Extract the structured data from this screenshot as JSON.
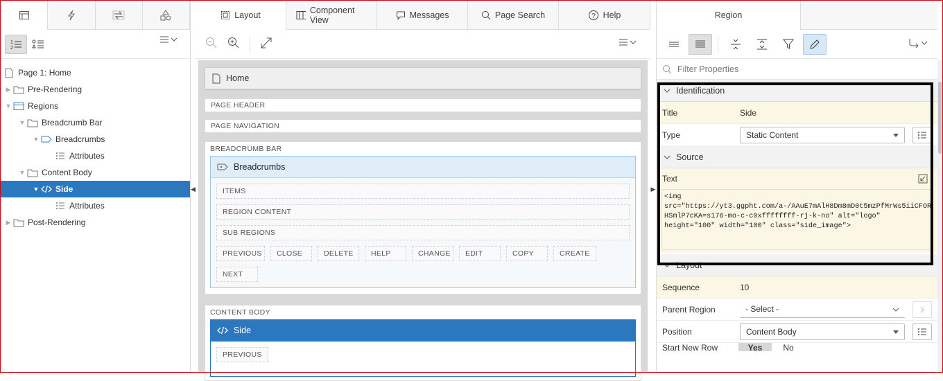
{
  "left": {
    "tabs": [
      "rendering-tab",
      "dynamic-actions-tab",
      "processing-tab",
      "shared-components-tab"
    ],
    "tree": [
      {
        "label": "Page 1: Home",
        "depth": 0,
        "toggle": "",
        "icon": "page"
      },
      {
        "label": "Pre-Rendering",
        "depth": 0,
        "toggle": "▶",
        "icon": "folder"
      },
      {
        "label": "Regions",
        "depth": 0,
        "toggle": "▼",
        "icon": "region"
      },
      {
        "label": "Breadcrumb Bar",
        "depth": 1,
        "toggle": "▼",
        "icon": "folder"
      },
      {
        "label": "Breadcrumbs",
        "depth": 2,
        "toggle": "▼",
        "icon": "breadcrumb"
      },
      {
        "label": "Attributes",
        "depth": 3,
        "toggle": "",
        "icon": "list"
      },
      {
        "label": "Content Body",
        "depth": 1,
        "toggle": "▼",
        "icon": "folder"
      },
      {
        "label": "Side",
        "depth": 2,
        "toggle": "▼",
        "icon": "code",
        "selected": true
      },
      {
        "label": "Attributes",
        "depth": 3,
        "toggle": "",
        "icon": "list"
      },
      {
        "label": "Post-Rendering",
        "depth": 0,
        "toggle": "▶",
        "icon": "folder"
      }
    ]
  },
  "middle": {
    "tabs": {
      "layout": "Layout",
      "component_view": "Component View",
      "messages": "Messages",
      "page_search": "Page Search",
      "help": "Help"
    },
    "page_title": "Home",
    "page_header": "PAGE HEADER",
    "page_navigation": "PAGE NAVIGATION",
    "breadcrumb_bar": "BREADCRUMB BAR",
    "breadcrumbs_region": "Breadcrumbs",
    "items": "ITEMS",
    "region_content": "REGION CONTENT",
    "sub_regions": "SUB REGIONS",
    "buttons": [
      "PREVIOUS",
      "CLOSE",
      "DELETE",
      "HELP",
      "CHANGE",
      "EDIT",
      "COPY",
      "CREATE",
      "NEXT"
    ],
    "content_body": "CONTENT BODY",
    "side_region": "Side",
    "side_previous": "PREVIOUS"
  },
  "right": {
    "tab": "Region",
    "filter_placeholder": "Filter Properties",
    "identification": "Identification",
    "title_label": "Title",
    "title_value": "Side",
    "type_label": "Type",
    "type_value": "Static Content",
    "source": "Source",
    "text_label": "Text",
    "text_value": "<img\nsrc=\"https://yt3.ggpht.com/a-/AAuE7mAlH8Dm8mD0t5mzPfMrWs5iiCFOR\nHSmlP7cKA=s176-mo-c-c0xffffffff-rj-k-no\" alt=\"logo\"\nheight=\"100\" width=\"100\" class=\"side_image\">",
    "layout": "Layout",
    "sequence_label": "Sequence",
    "sequence_value": "10",
    "parent_region_label": "Parent Region",
    "parent_region_value": "- Select -",
    "position_label": "Position",
    "position_value": "Content Body",
    "start_new_row_label": "Start New Row",
    "yes": "Yes",
    "no": "No"
  },
  "colors": {
    "selected": "#2c78bf",
    "highlight_row": "#fcf6e4",
    "frame": "#d0021b"
  }
}
